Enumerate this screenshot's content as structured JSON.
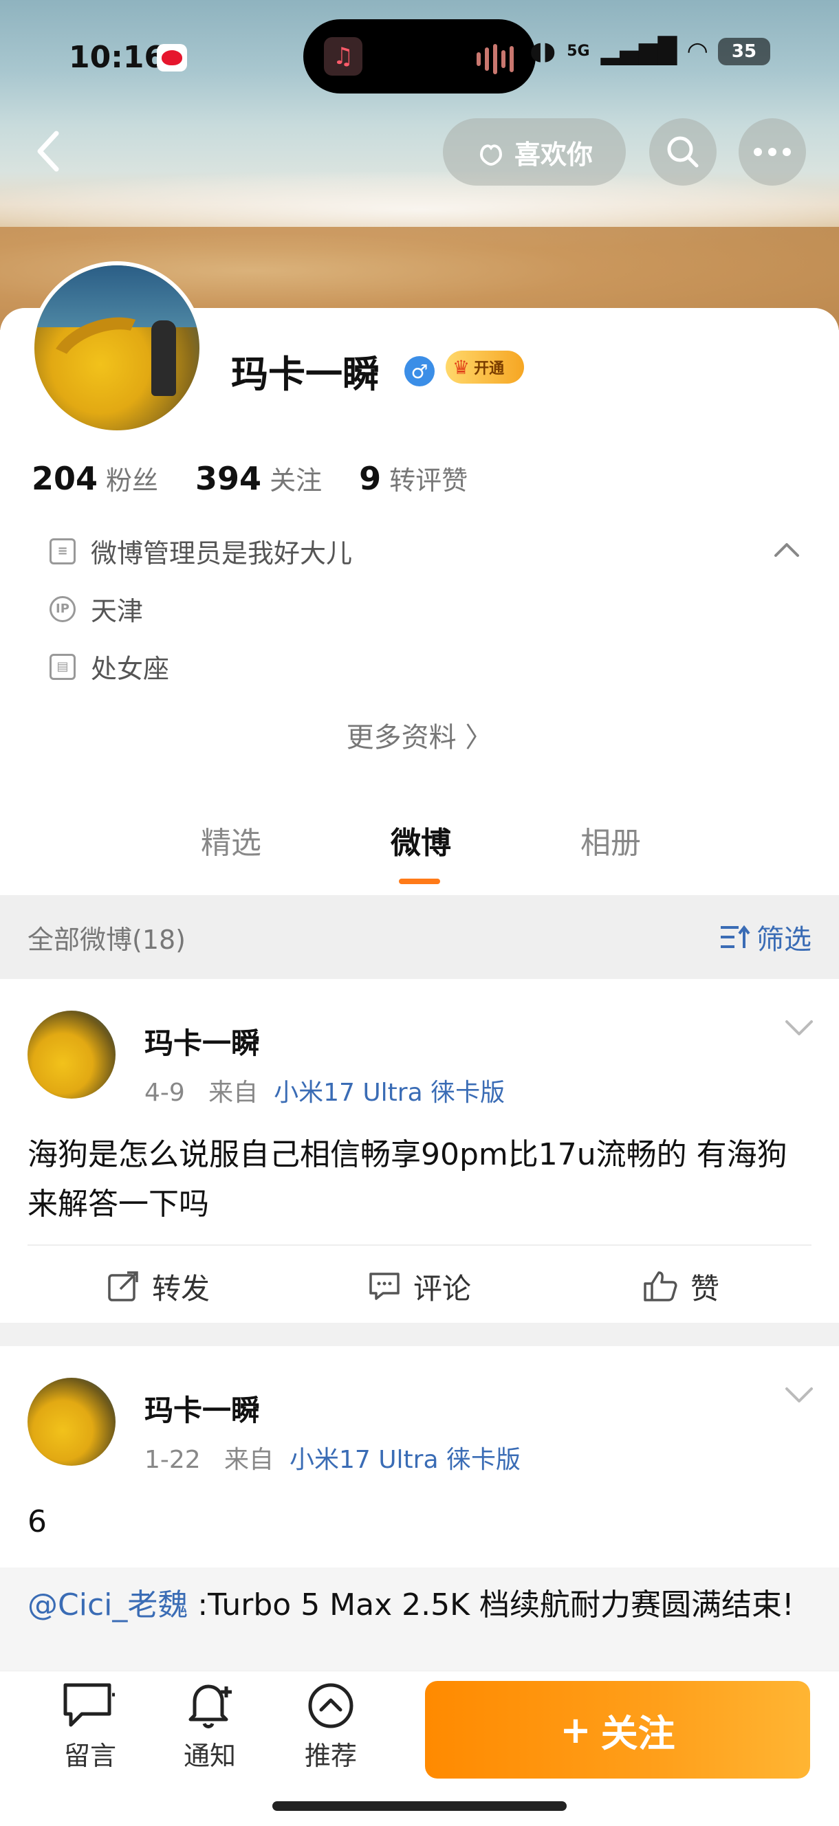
{
  "status_bar": {
    "time": "10:16",
    "network": "5G",
    "battery": "35"
  },
  "nav": {
    "like_label": "喜欢你"
  },
  "profile": {
    "username": "玛卡一瞬",
    "gender_symbol": "♂",
    "vip_label": "开通",
    "stats": [
      {
        "value": "204",
        "label": "粉丝"
      },
      {
        "value": "394",
        "label": "关注"
      },
      {
        "value": "9",
        "label": "转评赞"
      }
    ],
    "bio": "微博管理员是我好大儿",
    "location_badge": "IP",
    "location": "天津",
    "zodiac": "处女座",
    "more_info": "更多资料 〉"
  },
  "tabs": [
    "精选",
    "微博",
    "相册"
  ],
  "active_tab": "微博",
  "feed_header": {
    "title": "全部微博(18)",
    "filter_label": "筛选"
  },
  "posts": [
    {
      "author": "玛卡一瞬",
      "date": "4-9",
      "from_label": "来自",
      "source": "小米17 Ultra 徕卡版",
      "text": "海狗是怎么说服自己相信畅享90pm比17u流畅的 有海狗来解答一下吗",
      "actions": {
        "repost": "转发",
        "comment": "评论",
        "like": "赞"
      }
    },
    {
      "author": "玛卡一瞬",
      "date": "1-22",
      "from_label": "来自",
      "source": "小米17 Ultra 徕卡版",
      "text": "6",
      "quote_user": "@Cici_老魏",
      "quote_text": " :Turbo 5 Max 2.5K 档续航耐力赛圆满结束!"
    }
  ],
  "bottom_bar": {
    "message": "留言",
    "notify": "通知",
    "recommend": "推荐",
    "follow": "关注",
    "follow_plus": "+"
  },
  "colors": {
    "accent": "#ff8a00",
    "link": "#3a6cb5"
  }
}
